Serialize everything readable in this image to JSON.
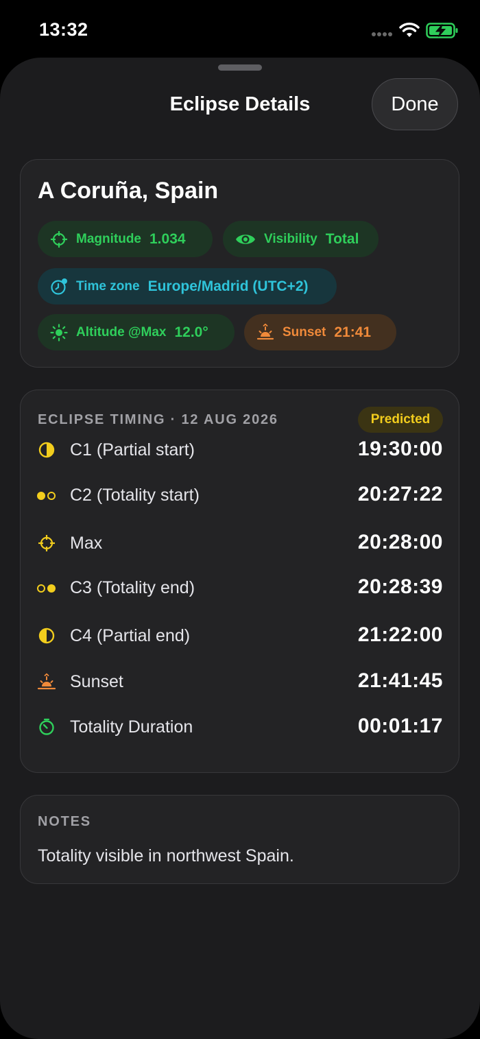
{
  "status": {
    "time": "13:32"
  },
  "sheet": {
    "title": "Eclipse Details",
    "done_label": "Done"
  },
  "location": {
    "name": "A Coruña, Spain",
    "chips": {
      "magnitude": {
        "label": "Magnitude",
        "value": "1.034",
        "icon": "crosshair-icon"
      },
      "visibility": {
        "label": "Visibility",
        "value": "Total",
        "icon": "eye-icon"
      },
      "timezone": {
        "label": "Time zone",
        "value": "Europe/Madrid (UTC+2)",
        "icon": "clock-icon"
      },
      "altitude": {
        "label": "Altitude @Max",
        "value": "12.0°",
        "icon": "sun-icon"
      },
      "sunset": {
        "label": "Sunset",
        "value": "21:41",
        "icon": "sunset-icon"
      }
    }
  },
  "timing": {
    "header": "ECLIPSE TIMING · 12 AUG 2026",
    "badge": "Predicted",
    "rows": [
      {
        "label": "C1 (Partial start)",
        "value": "19:30:00",
        "icon": "half-circle-icon"
      },
      {
        "label": "C2 (Totality start)",
        "value": "20:27:22",
        "icon": "two-dots-icon"
      },
      {
        "label": "Max",
        "value": "20:28:00",
        "icon": "crosshair-icon"
      },
      {
        "label": "C3 (Totality end)",
        "value": "20:28:39",
        "icon": "two-dots-icon"
      },
      {
        "label": "C4 (Partial end)",
        "value": "21:22:00",
        "icon": "half-circle-icon"
      },
      {
        "label": "Sunset",
        "value": "21:41:45",
        "icon": "sunset-icon"
      },
      {
        "label": "Totality Duration",
        "value": "00:01:17",
        "icon": "timer-icon"
      }
    ]
  },
  "notes": {
    "label": "NOTES",
    "text": "Totality visible in northwest Spain."
  },
  "colors": {
    "green": "#2fcf5b",
    "teal": "#2fc4da",
    "orange": "#f08a3a",
    "yellow": "#f2cd1d",
    "sheet": "#1c1c1e"
  }
}
